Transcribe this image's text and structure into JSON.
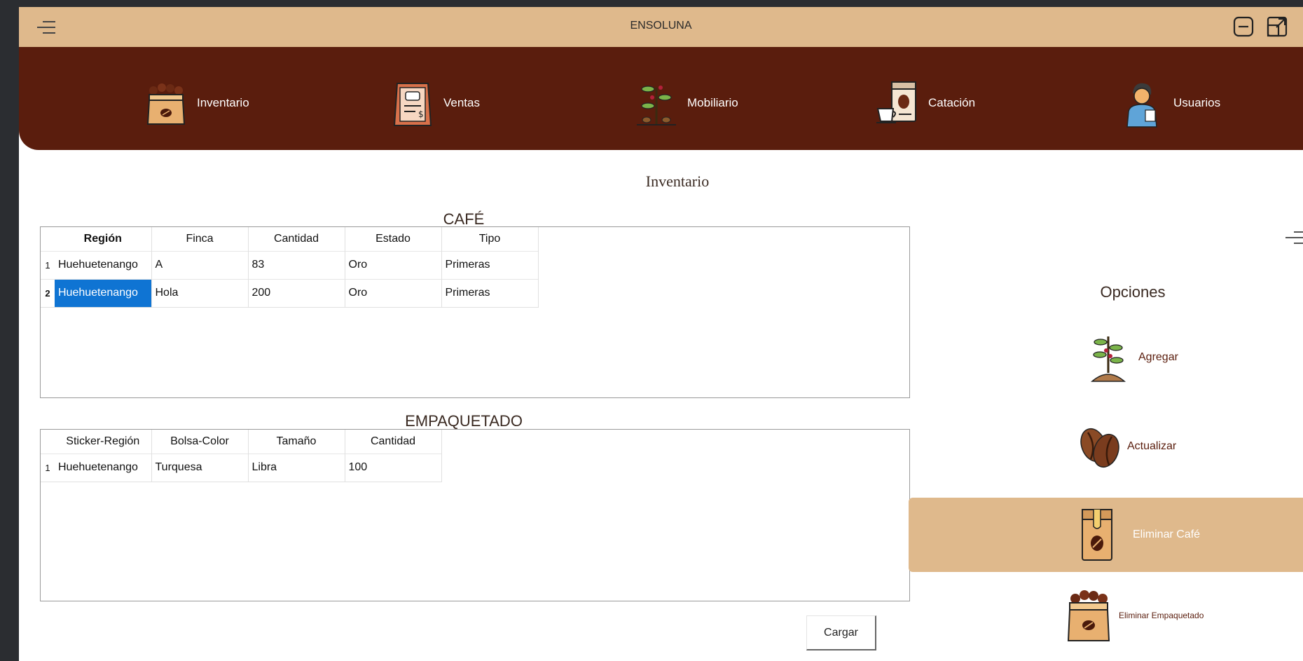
{
  "app": {
    "title": "ENSOLUNA"
  },
  "nav": [
    {
      "label": "Inventario",
      "icon": "coffee-sack-icon"
    },
    {
      "label": "Ventas",
      "icon": "menu-board-icon"
    },
    {
      "label": "Mobiliario",
      "icon": "coffee-plant-icon"
    },
    {
      "label": "Catación",
      "icon": "coffee-cup-bag-icon"
    },
    {
      "label": "Usuarios",
      "icon": "user-icon"
    }
  ],
  "page": {
    "title": "Inventario"
  },
  "cafe": {
    "title": "CAFÉ",
    "columns": [
      "Región",
      "Finca",
      "Cantidad",
      "Estado",
      "Tipo"
    ],
    "rows": [
      {
        "num": "1",
        "cells": [
          "Huehuetenango",
          "A",
          "83",
          "Oro",
          "Primeras"
        ]
      },
      {
        "num": "2",
        "cells": [
          "Huehuetenango",
          "Hola",
          "200",
          "Oro",
          "Primeras"
        ]
      }
    ]
  },
  "empaquetado": {
    "title": "EMPAQUETADO",
    "columns": [
      "Sticker-Región",
      "Bolsa-Color",
      "Tamaño",
      "Cantidad"
    ],
    "rows": [
      {
        "num": "1",
        "cells": [
          "Huehuetenango",
          "Turquesa",
          "Libra",
          "100"
        ]
      }
    ]
  },
  "options": {
    "title": "Opciones",
    "items": [
      {
        "label": "Agregar",
        "icon": "coffee-plant-icon"
      },
      {
        "label": "Actualizar",
        "icon": "coffee-beans-icon"
      },
      {
        "label": "Eliminar Café",
        "icon": "coffee-bag-icon"
      },
      {
        "label": "Eliminar Empaquetado",
        "icon": "coffee-sack-icon"
      }
    ]
  },
  "actions": {
    "load_label": "Cargar"
  },
  "colors": {
    "titlebar": "#dfb98c",
    "navbar": "#5a1d0d",
    "selection": "#0f74d3",
    "active_option": "#dfb98c"
  }
}
